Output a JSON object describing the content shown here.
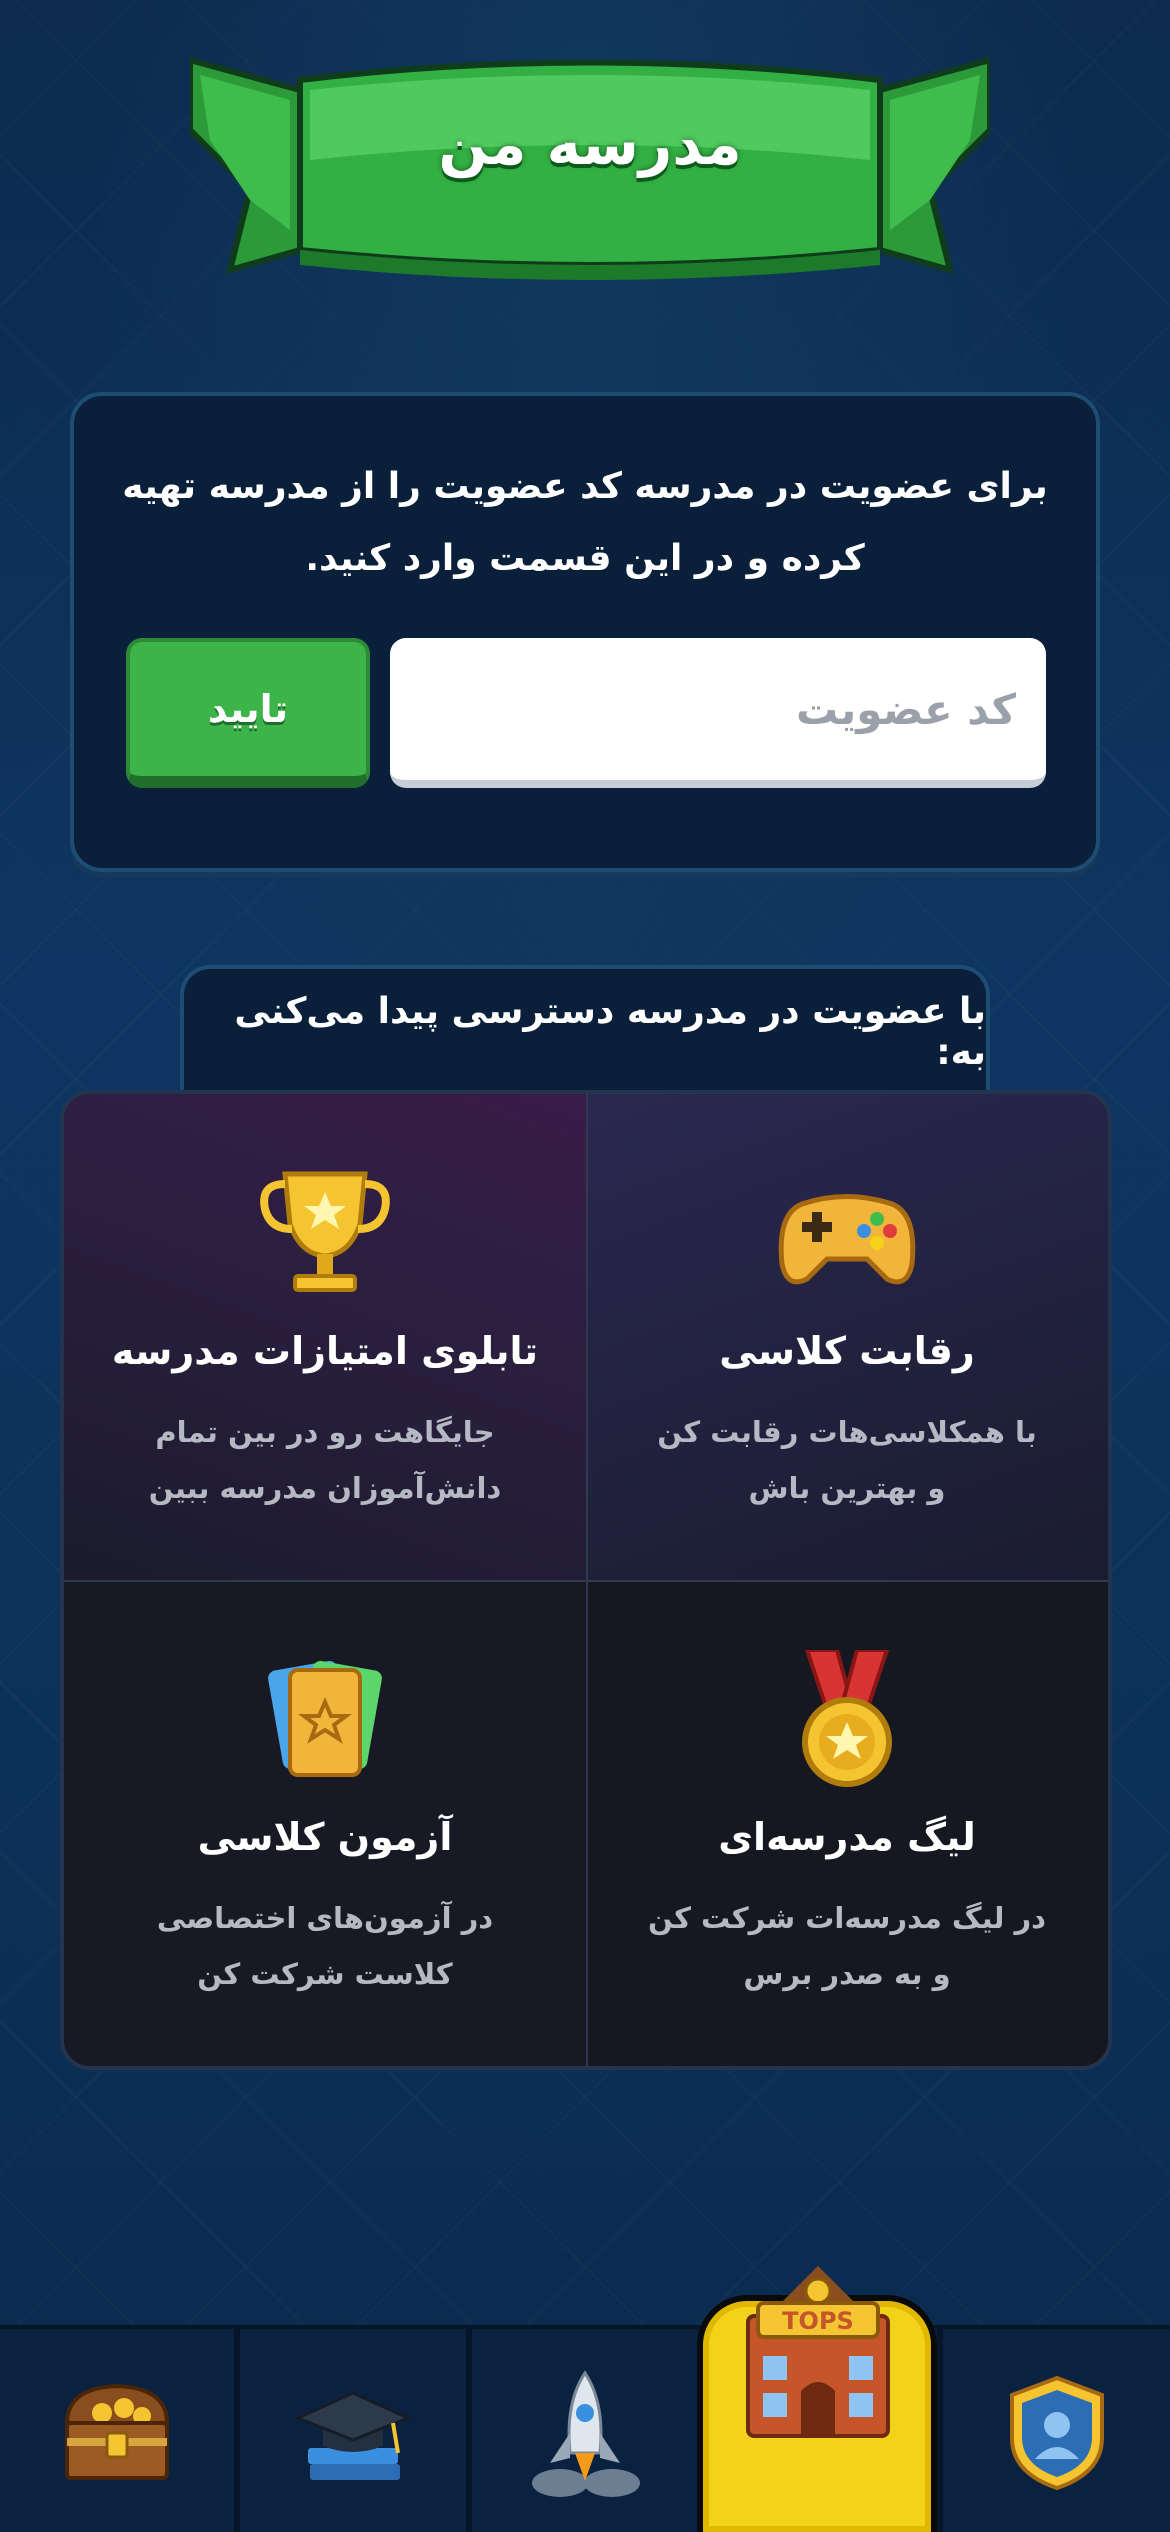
{
  "banner": {
    "title": "مدرسه من"
  },
  "join": {
    "instruction": "برای عضویت در مدرسه کد عضویت را از مدرسه تهیه کرده و در این قسمت وارد کنید.",
    "input_placeholder": "کد عضویت",
    "confirm_label": "تایید"
  },
  "benefits": {
    "header": "با عضویت در مدرسه دسترسی پیدا می‌کنی به:",
    "items": [
      {
        "title": "رقابت کلاسی",
        "desc": "با همکلاسی‌هات رقابت کن و بهترین باش",
        "icon": "gamepad-icon"
      },
      {
        "title": "تابلوی امتیازات مدرسه",
        "desc": "جایگاهت رو در بین تمام دانش‌آموزان مدرسه ببین",
        "icon": "trophy-icon"
      },
      {
        "title": "لیگ مدرسه‌ای",
        "desc": "در لیگ مدرسه‌ات شرکت کن و به صدر برس",
        "icon": "medal-icon"
      },
      {
        "title": "آزمون کلاسی",
        "desc": "در آزمون‌های اختصاصی کلاست شرکت کن",
        "icon": "cards-icon"
      }
    ]
  },
  "nav": {
    "items": [
      {
        "name": "treasure-chest",
        "icon": "treasure-chest-icon"
      },
      {
        "name": "education",
        "icon": "graduation-cap-icon"
      },
      {
        "name": "rocket",
        "icon": "rocket-icon"
      },
      {
        "name": "school",
        "icon": "school-building-icon",
        "badge": "TOPS",
        "active": true
      },
      {
        "name": "profile",
        "icon": "profile-shield-icon"
      }
    ]
  },
  "colors": {
    "accent_green": "#3cb449",
    "nav_active": "#f2d31a",
    "background": "#0b2a4a"
  }
}
